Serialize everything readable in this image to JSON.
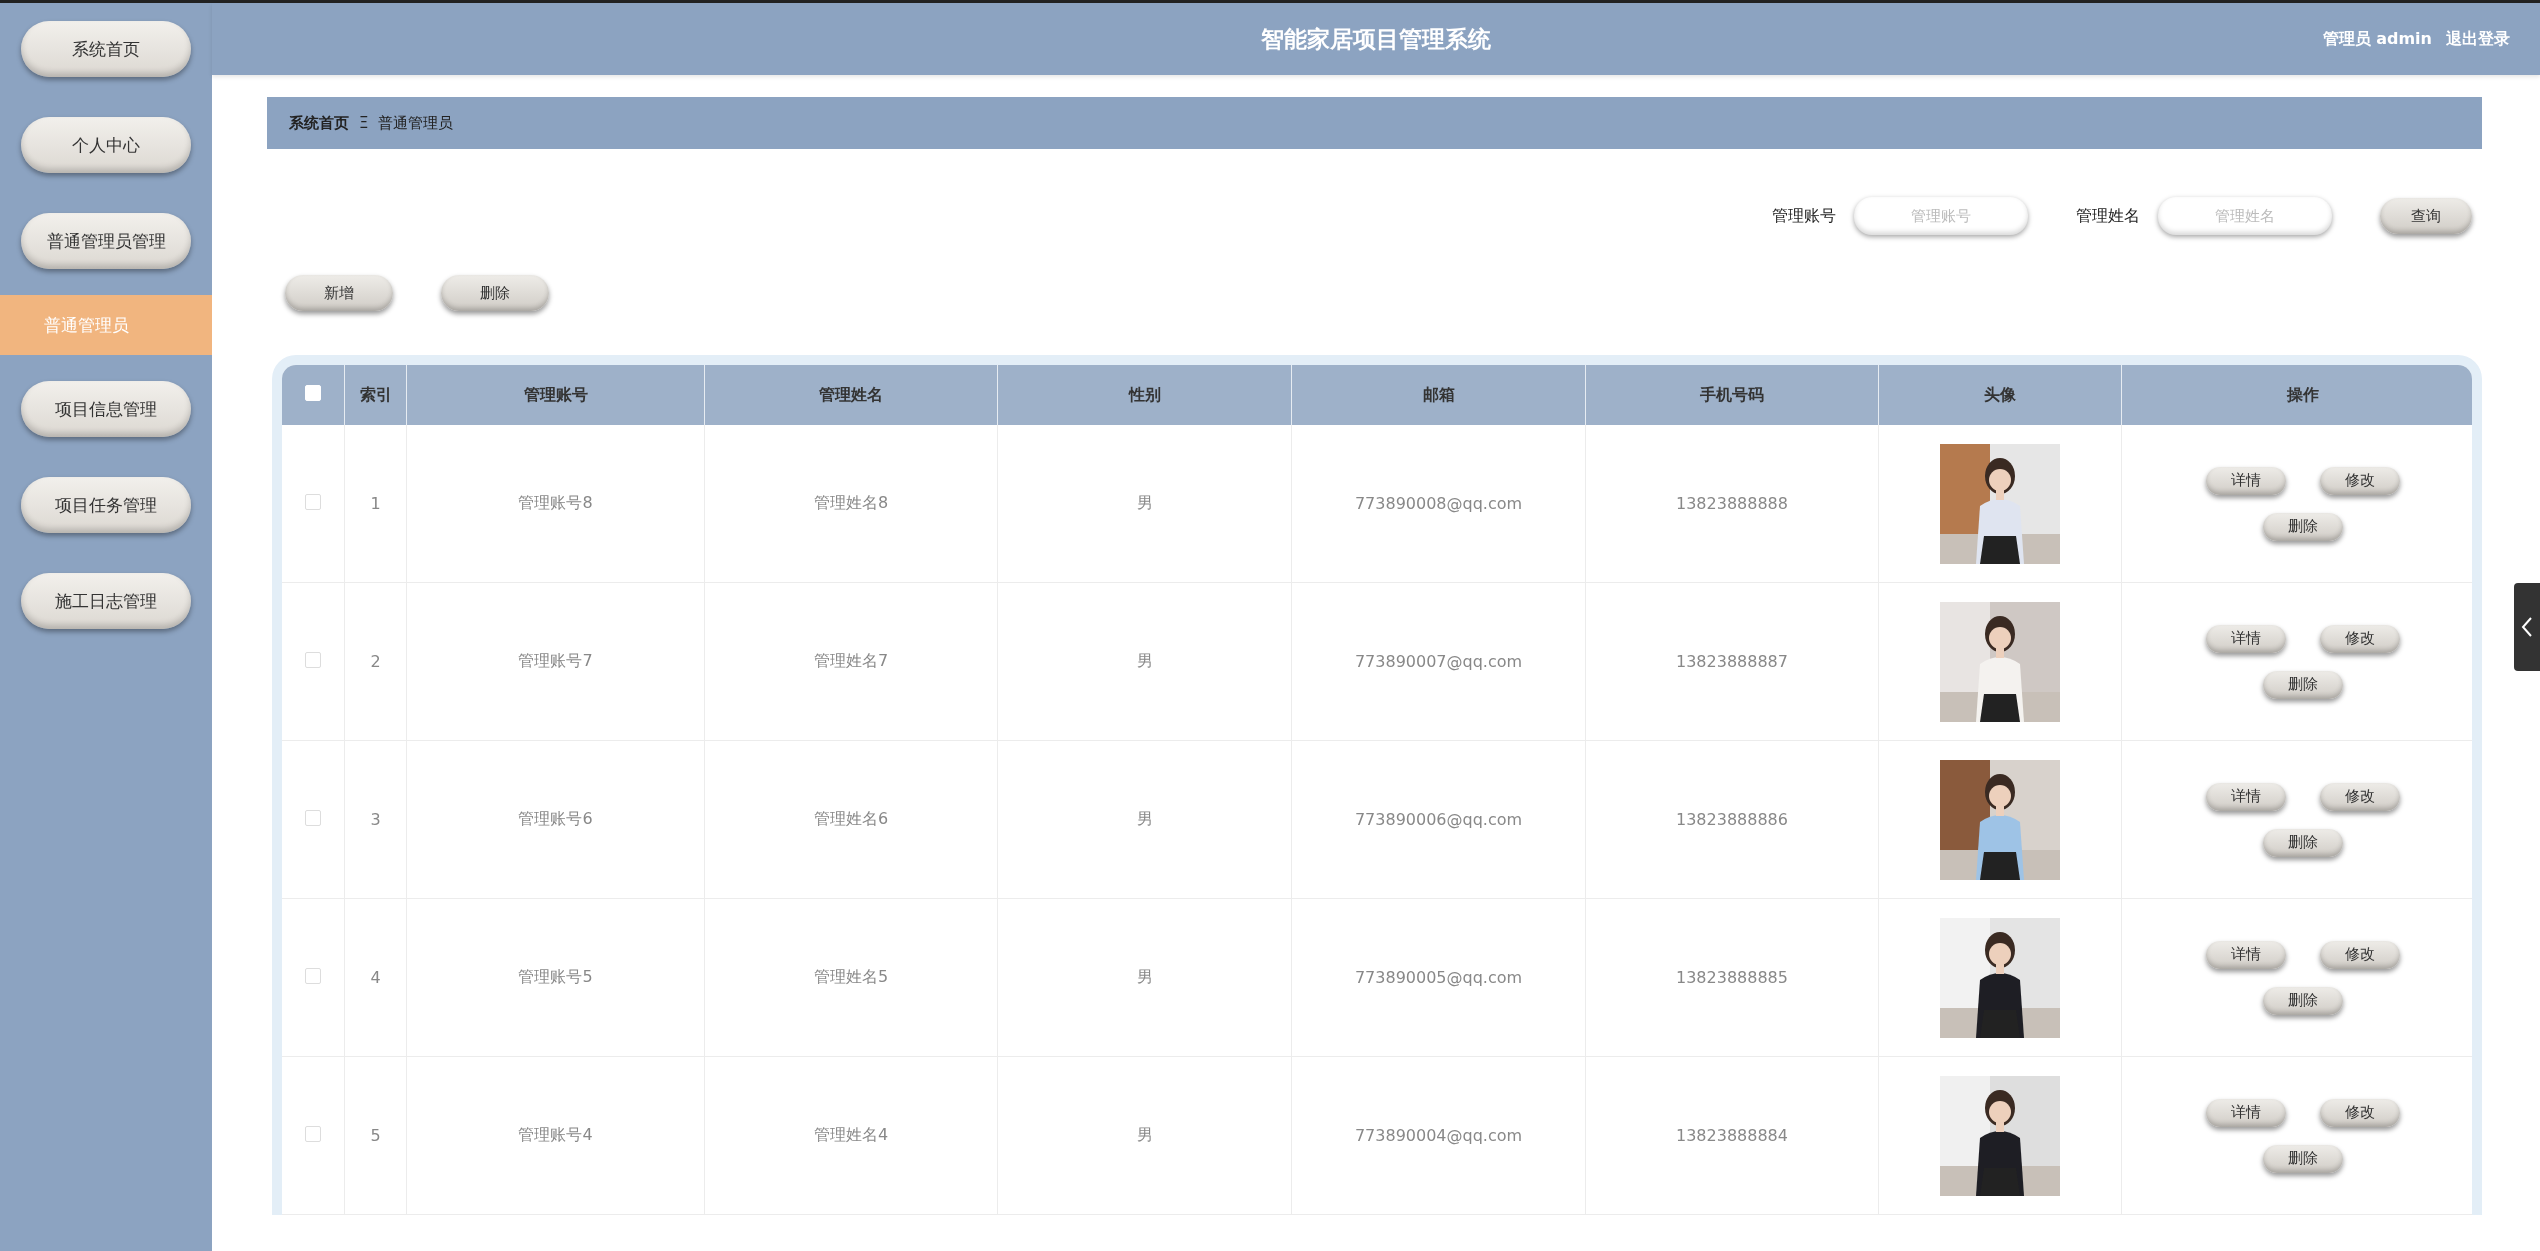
{
  "header": {
    "title": "智能家居项目管理系统",
    "user": "管理员 admin",
    "logout": "退出登录"
  },
  "sidebar": {
    "items": [
      {
        "label": "系统首页",
        "selected": false
      },
      {
        "label": "个人中心",
        "selected": false
      },
      {
        "label": "普通管理员管理",
        "selected": false,
        "children": [
          {
            "label": "普通管理员",
            "selected": true
          }
        ]
      },
      {
        "label": "项目信息管理",
        "selected": false
      },
      {
        "label": "项目任务管理",
        "selected": false
      },
      {
        "label": "施工日志管理",
        "selected": false
      }
    ]
  },
  "breadcrumb": {
    "home": "系统首页",
    "separator": "Ξ",
    "current": "普通管理员"
  },
  "search": {
    "fields": [
      {
        "label": "管理账号",
        "placeholder": "管理账号"
      },
      {
        "label": "管理姓名",
        "placeholder": "管理姓名"
      }
    ],
    "button": "查询"
  },
  "actions": [
    "新增",
    "删除"
  ],
  "table": {
    "header_checked": false,
    "columns": [
      "索引",
      "管理账号",
      "管理姓名",
      "性别",
      "邮箱",
      "手机号码",
      "头像",
      "操作"
    ],
    "rows": [
      {
        "checked": false,
        "cells": [
          "1",
          "管理账号8",
          "管理姓名8",
          "男",
          "773890008@qq.com",
          "13823888888"
        ],
        "actions": [
          "详情",
          "修改",
          "删除"
        ]
      },
      {
        "checked": false,
        "cells": [
          "2",
          "管理账号7",
          "管理姓名7",
          "男",
          "773890007@qq.com",
          "13823888887"
        ],
        "actions": [
          "详情",
          "修改",
          "删除"
        ]
      },
      {
        "checked": false,
        "cells": [
          "3",
          "管理账号6",
          "管理姓名6",
          "男",
          "773890006@qq.com",
          "13823888886"
        ],
        "actions": [
          "详情",
          "修改",
          "删除"
        ]
      },
      {
        "checked": false,
        "cells": [
          "4",
          "管理账号5",
          "管理姓名5",
          "男",
          "773890005@qq.com",
          "13823888885"
        ],
        "actions": [
          "详情",
          "修改",
          "删除"
        ]
      },
      {
        "checked": false,
        "cells": [
          "5",
          "管理账号4",
          "管理姓名4",
          "男",
          "773890004@qq.com",
          "13823888884"
        ],
        "actions": [
          "详情",
          "修改",
          "删除"
        ]
      }
    ]
  }
}
